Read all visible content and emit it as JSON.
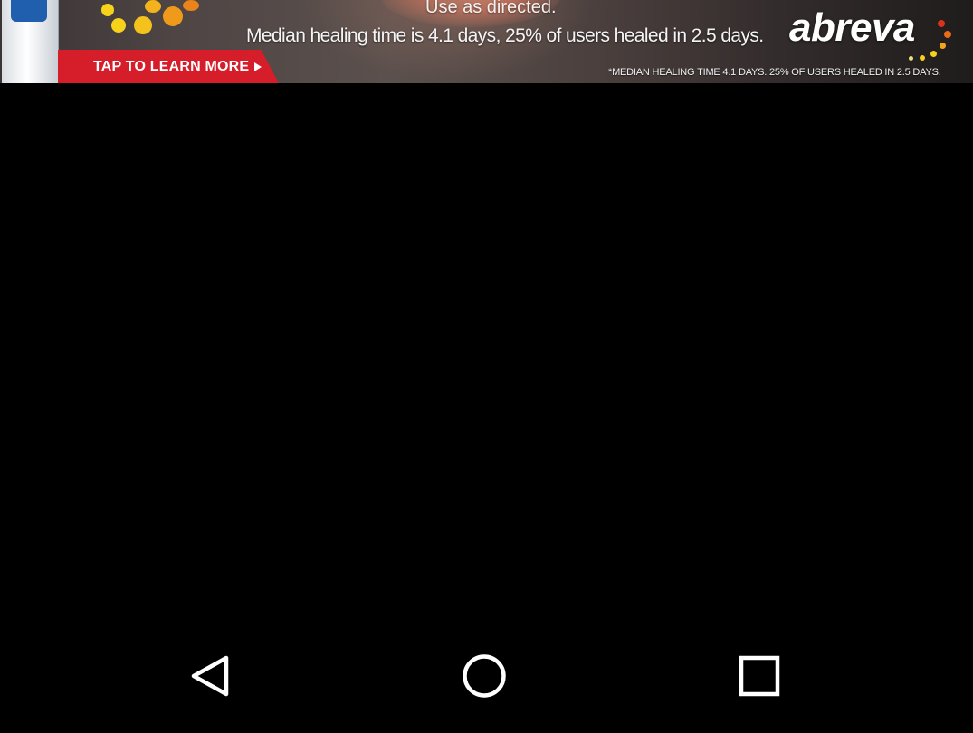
{
  "ad": {
    "line1": "Use as directed.",
    "line2": "Median healing time is 4.1 days, 25% of users healed in 2.5 days.",
    "cta": "TAP TO LEARN MORE",
    "brand": "abreva",
    "footnote": "*MEDIAN HEALING TIME 4.1 DAYS. 25% OF USERS HEALED IN 2.5 DAYS.",
    "colors": {
      "cta_strip": "#d61e2b",
      "accent_dots": [
        "#f7d21a",
        "#f3a31c",
        "#e96a1a",
        "#d9341b"
      ]
    }
  },
  "navbar": {
    "back": {
      "icon": "back-triangle-icon"
    },
    "home": {
      "icon": "home-circle-icon"
    },
    "recents": {
      "icon": "recents-square-icon"
    }
  }
}
